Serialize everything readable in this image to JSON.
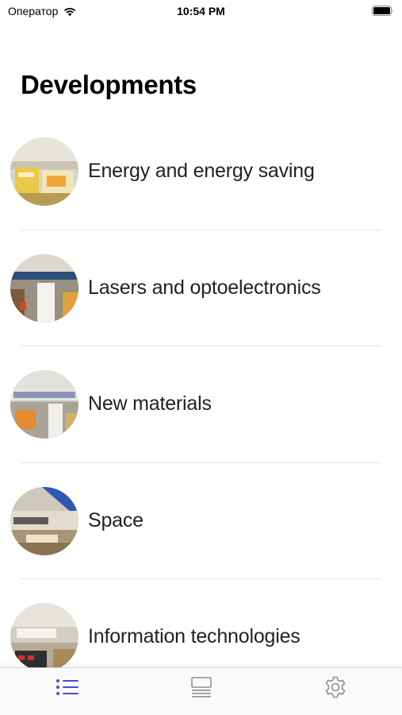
{
  "status_bar": {
    "carrier": "Оператор",
    "time": "10:54 PM",
    "icons": [
      "wifi-icon",
      "battery-icon"
    ]
  },
  "page": {
    "title": "Developments"
  },
  "list": {
    "items": [
      {
        "label": "Energy and energy saving",
        "thumbnail": "exhibit-photo"
      },
      {
        "label": "Lasers and optoelectronics",
        "thumbnail": "exhibit-photo"
      },
      {
        "label": "New materials",
        "thumbnail": "exhibit-photo"
      },
      {
        "label": "Space",
        "thumbnail": "exhibit-photo"
      },
      {
        "label": "Information technologies",
        "thumbnail": "exhibit-photo"
      }
    ]
  },
  "tab_bar": {
    "tabs": [
      {
        "icon": "list-icon",
        "active": true
      },
      {
        "icon": "catalog-icon",
        "active": false
      },
      {
        "icon": "gear-icon",
        "active": false
      }
    ],
    "active_color": "#4b4bd2",
    "inactive_color": "#8e8e93"
  }
}
